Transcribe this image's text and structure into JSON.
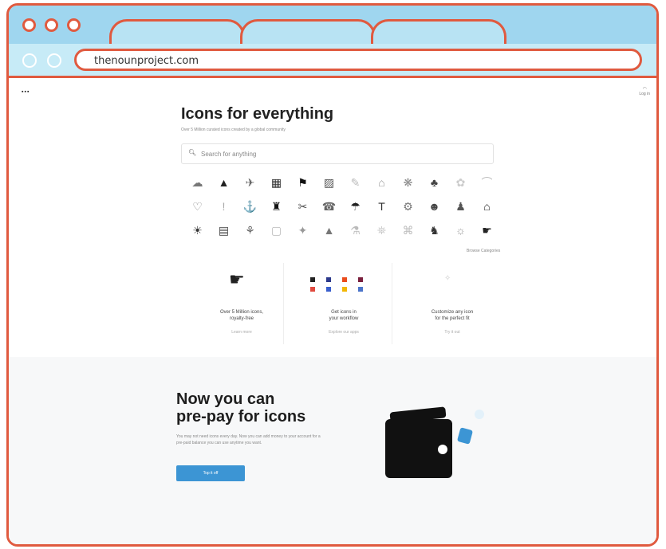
{
  "browser": {
    "url": "thenounproject.com",
    "window_dots": [
      "close",
      "minimize",
      "maximize"
    ],
    "nav_dots": [
      "back",
      "forward"
    ],
    "tabs": [
      "",
      "",
      ""
    ],
    "colors": {
      "frame": "#e05a3f",
      "titlebar": "#9fd6ef",
      "address_bar": "#c7ebf7"
    }
  },
  "page": {
    "logo": "▪▪▪",
    "login": "Log in",
    "hero": {
      "title": "Icons for everything",
      "subtitle": "Over 5 Million curated icons created by a global community",
      "search_placeholder": "Search for anything"
    },
    "icon_grid": [
      "☁",
      "▲",
      "✈",
      "▦",
      "⚑",
      "▨",
      "✎",
      "⌂",
      "❋",
      "♣",
      "✿",
      "⌒",
      "♡",
      "!",
      "⚓",
      "♜",
      "✂",
      "☎",
      "☂",
      "T",
      "⚙",
      "☻",
      "♟",
      "⌂",
      "☀",
      "▤",
      "⚘",
      "▢",
      "✦",
      "▲",
      "⚗",
      "⛯",
      "⌘",
      "♞",
      "☼",
      "☛"
    ],
    "icon_colors": [
      "#777",
      "#222",
      "#666",
      "#333",
      "#111",
      "#555",
      "#bbb",
      "#999",
      "#888",
      "#444",
      "#ccc",
      "#bbb",
      "#888",
      "#aaa",
      "#333",
      "#111",
      "#555",
      "#666",
      "#222",
      "#333",
      "#777",
      "#444",
      "#555",
      "#222",
      "#333",
      "#444",
      "#666",
      "#bbb",
      "#999",
      "#777",
      "#bbb",
      "#ccc",
      "#bbb",
      "#333",
      "#999",
      "#222"
    ],
    "browse_link": "Browse Categories",
    "features": [
      {
        "title_line1": "Over 5 Million icons,",
        "title_line2": "royalty-free",
        "link": "Learn more"
      },
      {
        "title_line1": "Get icons in",
        "title_line2": "your workflow",
        "link": "Explore our apps"
      },
      {
        "title_line1": "Customize any icon",
        "title_line2": "for the perfect fit",
        "link": "Try it out"
      }
    ],
    "prepay": {
      "title_line1": "Now you can",
      "title_line2": "pre-pay for icons",
      "text": "You may not need icons every day. Now you can add money to your account for a pre-paid balance you can use anytime you want.",
      "button": "Top it off"
    }
  }
}
